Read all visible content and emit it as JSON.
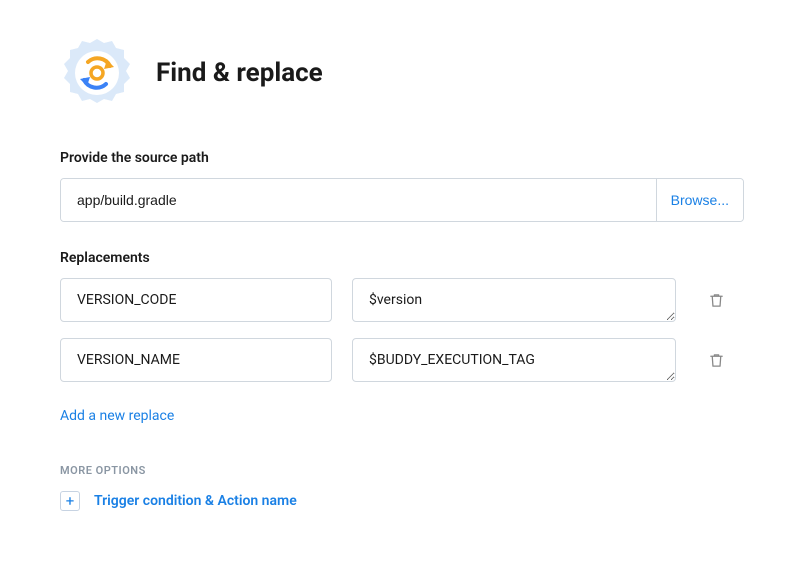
{
  "header": {
    "title": "Find & replace"
  },
  "source": {
    "label": "Provide the source path",
    "value": "app/build.gradle",
    "browse_label": "Browse..."
  },
  "replacements": {
    "label": "Replacements",
    "rows": [
      {
        "find": "VERSION_CODE",
        "replace": "$version"
      },
      {
        "find": "VERSION_NAME",
        "replace": "$BUDDY_EXECUTION_TAG"
      }
    ],
    "add_label": "Add a new replace"
  },
  "more_options": {
    "label": "MORE OPTIONS",
    "trigger_label": "Trigger condition & Action name"
  }
}
